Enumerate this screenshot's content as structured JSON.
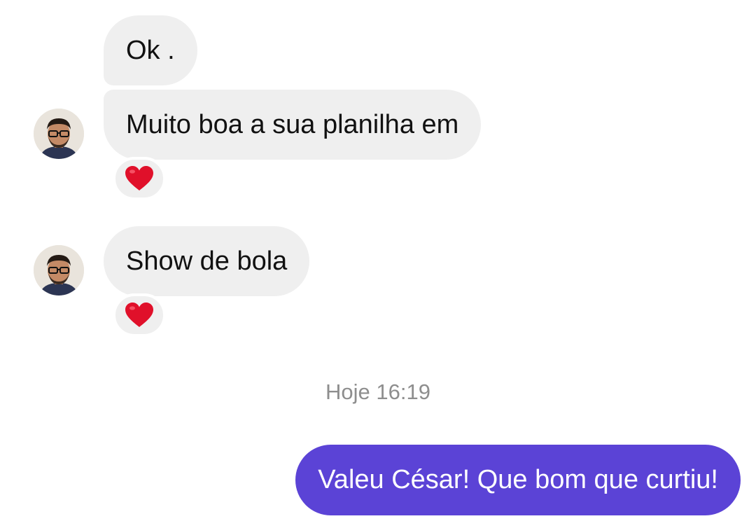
{
  "conversation": {
    "messages": [
      {
        "text": "Ok ."
      },
      {
        "text": "Muito boa a sua planilha em",
        "reaction": "heart-emoji"
      },
      {
        "text": "Show de bola",
        "reaction": "heart-emoji"
      }
    ],
    "timestamp": "Hoje 16:19",
    "sent_message": {
      "text": "Valeu César! Que bom que curtiu!"
    }
  },
  "colors": {
    "received_bubble": "#efefef",
    "sent_bubble": "#5b43d6",
    "timestamp_text": "#8e8e8e",
    "reaction_heart": "#e0102a"
  },
  "icons": {
    "avatar": "contact-avatar",
    "reaction": "heart-emoji"
  }
}
